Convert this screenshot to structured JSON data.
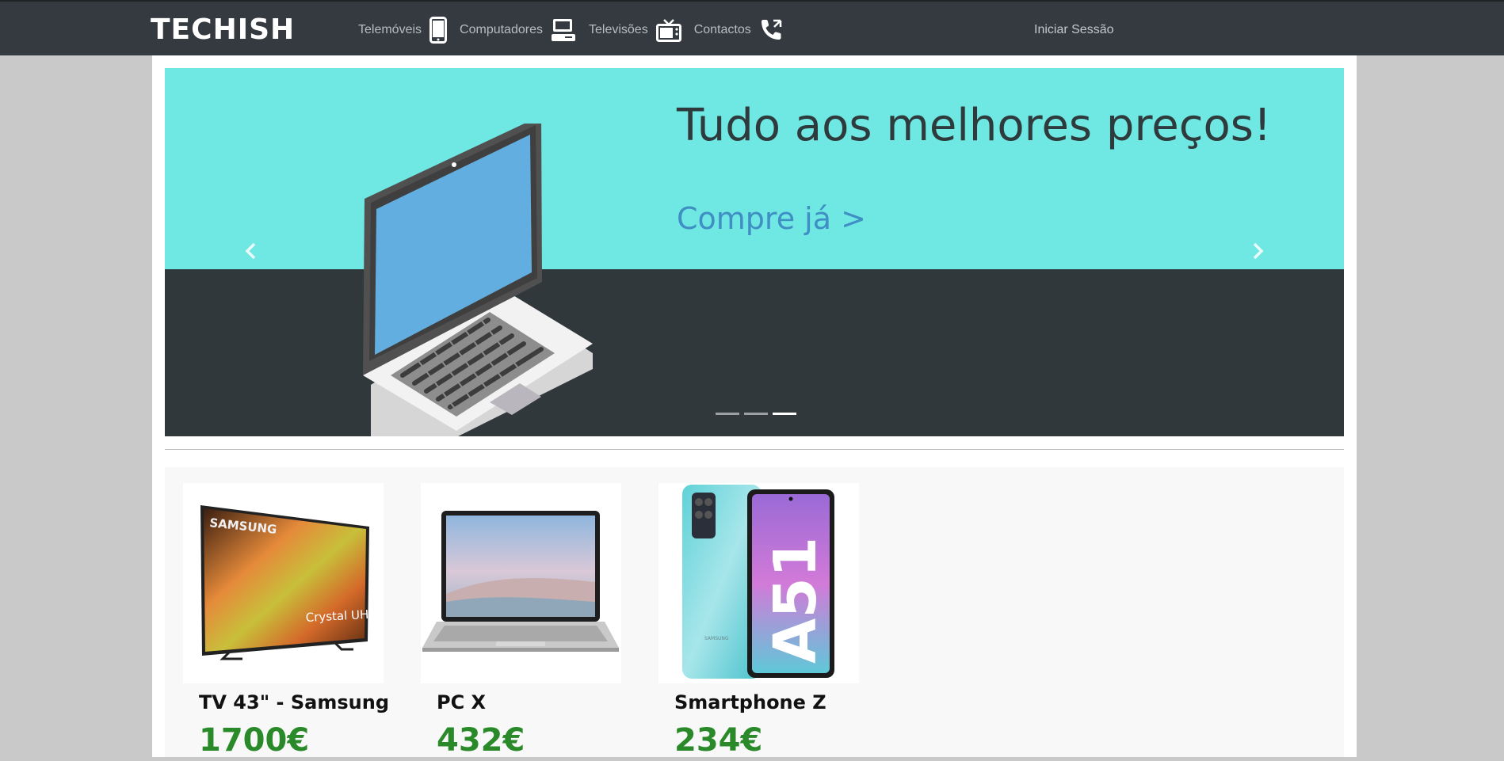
{
  "brand": {
    "logo": "TECHISH"
  },
  "nav": {
    "items": [
      {
        "label": "Telemóveis",
        "icon": "smartphone-icon"
      },
      {
        "label": "Computadores",
        "icon": "desktop-computer-icon"
      },
      {
        "label": "Televisões",
        "icon": "tv-icon"
      },
      {
        "label": "Contactos",
        "icon": "phone-icon"
      }
    ],
    "login": "Iniciar Sessão"
  },
  "carousel": {
    "headline": "Tudo aos melhores preços!",
    "cta": "Compre já >",
    "slide_count": 3,
    "active_slide": 3,
    "colors": {
      "top": "#6fe7e2",
      "bottom": "#30383b"
    }
  },
  "products": [
    {
      "name": "TV 43\" - Samsung",
      "price": "1700€",
      "image": "samsung-tv-image",
      "image_text": [
        "SAMSUNG",
        "Crystal UHD"
      ]
    },
    {
      "name": "PC X",
      "price": "432€",
      "image": "laptop-image"
    },
    {
      "name": "Smartphone Z",
      "price": "234€",
      "image": "smartphone-image",
      "image_text": [
        "A51",
        "SAMSUNG"
      ]
    }
  ]
}
